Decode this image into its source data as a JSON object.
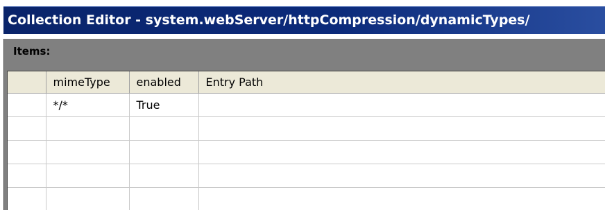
{
  "window": {
    "title": "Collection Editor - system.webServer/httpCompression/dynamicTypes/"
  },
  "panel": {
    "label": "Items:"
  },
  "grid": {
    "columns": [
      "mimeType",
      "enabled",
      "Entry Path"
    ],
    "rows": [
      {
        "mimeType": "*/*",
        "enabled": "True",
        "entryPath": ""
      },
      {
        "mimeType": "",
        "enabled": "",
        "entryPath": ""
      },
      {
        "mimeType": "",
        "enabled": "",
        "entryPath": ""
      },
      {
        "mimeType": "",
        "enabled": "",
        "entryPath": ""
      },
      {
        "mimeType": "",
        "enabled": "",
        "entryPath": ""
      }
    ]
  },
  "colors": {
    "titlebar": "#0a246a",
    "panel_background": "#808080",
    "header_background": "#ece9d8"
  }
}
